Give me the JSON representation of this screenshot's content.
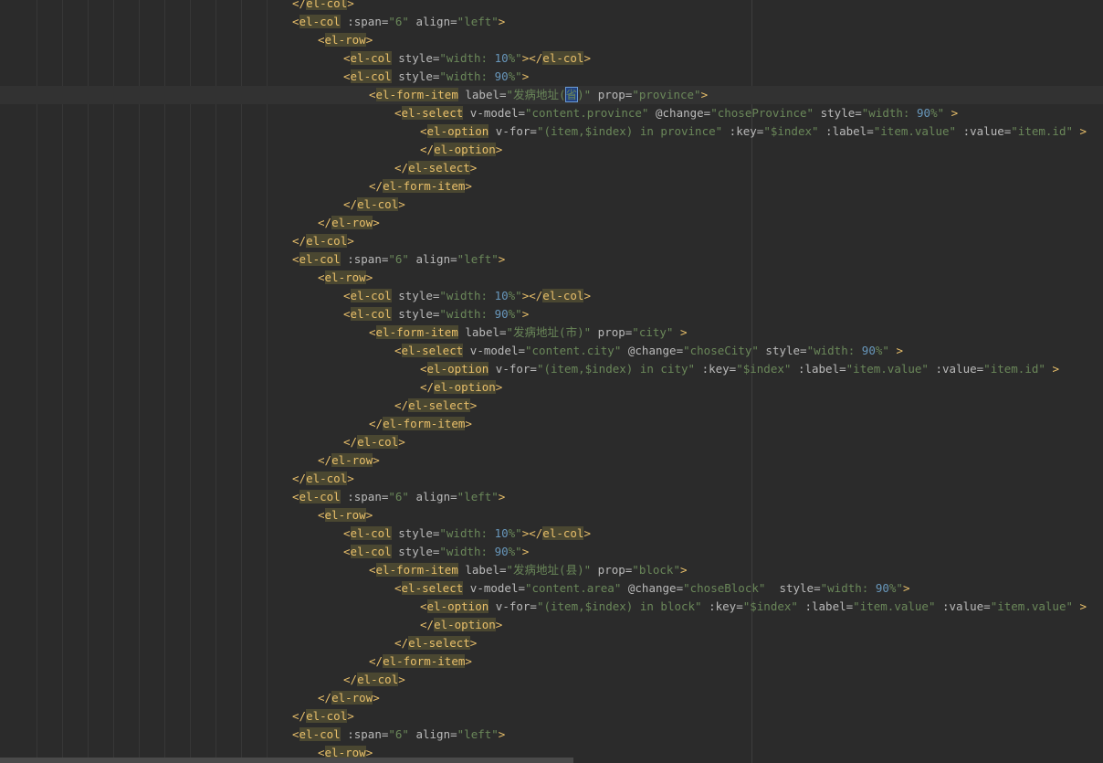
{
  "editor": {
    "lines": [
      [
        [
          "p",
          "</"
        ],
        [
          "t",
          "el-col"
        ],
        [
          "p",
          ">"
        ]
      ],
      [
        [
          "p",
          "<"
        ],
        [
          "t",
          "el-col"
        ],
        [
          "a",
          " :span="
        ],
        [
          "s",
          "\"6\""
        ],
        [
          "a",
          " align="
        ],
        [
          "s",
          "\"left\""
        ],
        [
          "p",
          ">"
        ]
      ],
      [
        [
          "p",
          "<"
        ],
        [
          "t",
          "el-row"
        ],
        [
          "p",
          ">"
        ]
      ],
      [
        [
          "p",
          "<"
        ],
        [
          "t",
          "el-col"
        ],
        [
          "a",
          " style="
        ],
        [
          "s",
          "\"width: "
        ],
        [
          "n",
          "10"
        ],
        [
          "s",
          "%\""
        ],
        [
          "p",
          "></"
        ],
        [
          "t",
          "el-col"
        ],
        [
          "p",
          ">"
        ]
      ],
      [
        [
          "p",
          "<"
        ],
        [
          "t",
          "el-col"
        ],
        [
          "a",
          " style="
        ],
        [
          "s",
          "\"width: "
        ],
        [
          "n",
          "90"
        ],
        [
          "s",
          "%\""
        ],
        [
          "p",
          ">"
        ]
      ],
      [
        [
          "p",
          "<"
        ],
        [
          "t",
          "el-form-item"
        ],
        [
          "a",
          " label="
        ],
        [
          "s",
          "\"发病地址("
        ],
        [
          "c",
          "省"
        ],
        [
          "s",
          ")\""
        ],
        [
          "a",
          " prop="
        ],
        [
          "s",
          "\"province\""
        ],
        [
          "p",
          ">"
        ]
      ],
      [
        [
          "p",
          "<"
        ],
        [
          "t",
          "el-select"
        ],
        [
          "a",
          " v-model="
        ],
        [
          "s",
          "\"content.province\""
        ],
        [
          "a",
          " @change="
        ],
        [
          "s",
          "\"choseProvince\""
        ],
        [
          "a",
          " style="
        ],
        [
          "s",
          "\"width: "
        ],
        [
          "n",
          "90"
        ],
        [
          "s",
          "%\""
        ],
        [
          "a",
          " "
        ],
        [
          "p",
          ">"
        ]
      ],
      [
        [
          "p",
          "<"
        ],
        [
          "t",
          "el-option"
        ],
        [
          "a",
          " v-for="
        ],
        [
          "s",
          "\"(item,$index) in province\""
        ],
        [
          "a",
          " :key="
        ],
        [
          "s",
          "\"$index\""
        ],
        [
          "a",
          " :label="
        ],
        [
          "s",
          "\"item.value\""
        ],
        [
          "a",
          " :value="
        ],
        [
          "s",
          "\"item.id\""
        ],
        [
          "a",
          " "
        ],
        [
          "p",
          ">"
        ]
      ],
      [
        [
          "p",
          "</"
        ],
        [
          "t",
          "el-option"
        ],
        [
          "p",
          ">"
        ]
      ],
      [
        [
          "p",
          "</"
        ],
        [
          "t",
          "el-select"
        ],
        [
          "p",
          ">"
        ]
      ],
      [
        [
          "p",
          "</"
        ],
        [
          "t",
          "el-form-item"
        ],
        [
          "p",
          ">"
        ]
      ],
      [
        [
          "p",
          "</"
        ],
        [
          "t",
          "el-col"
        ],
        [
          "p",
          ">"
        ]
      ],
      [
        [
          "p",
          "</"
        ],
        [
          "t",
          "el-row"
        ],
        [
          "p",
          ">"
        ]
      ],
      [
        [
          "p",
          "</"
        ],
        [
          "t",
          "el-col"
        ],
        [
          "p",
          ">"
        ]
      ],
      [
        [
          "p",
          "<"
        ],
        [
          "t",
          "el-col"
        ],
        [
          "a",
          " :span="
        ],
        [
          "s",
          "\"6\""
        ],
        [
          "a",
          " align="
        ],
        [
          "s",
          "\"left\""
        ],
        [
          "p",
          ">"
        ]
      ],
      [
        [
          "p",
          "<"
        ],
        [
          "t",
          "el-row"
        ],
        [
          "p",
          ">"
        ]
      ],
      [
        [
          "p",
          "<"
        ],
        [
          "t",
          "el-col"
        ],
        [
          "a",
          " style="
        ],
        [
          "s",
          "\"width: "
        ],
        [
          "n",
          "10"
        ],
        [
          "s",
          "%\""
        ],
        [
          "p",
          "></"
        ],
        [
          "t",
          "el-col"
        ],
        [
          "p",
          ">"
        ]
      ],
      [
        [
          "p",
          "<"
        ],
        [
          "t",
          "el-col"
        ],
        [
          "a",
          " style="
        ],
        [
          "s",
          "\"width: "
        ],
        [
          "n",
          "90"
        ],
        [
          "s",
          "%\""
        ],
        [
          "p",
          ">"
        ]
      ],
      [
        [
          "p",
          "<"
        ],
        [
          "t",
          "el-form-item"
        ],
        [
          "a",
          " label="
        ],
        [
          "s",
          "\"发病地址(市)\""
        ],
        [
          "a",
          " prop="
        ],
        [
          "s",
          "\"city\""
        ],
        [
          "a",
          " "
        ],
        [
          "p",
          ">"
        ]
      ],
      [
        [
          "p",
          "<"
        ],
        [
          "t",
          "el-select"
        ],
        [
          "a",
          " v-model="
        ],
        [
          "s",
          "\"content.city\""
        ],
        [
          "a",
          " @change="
        ],
        [
          "s",
          "\"choseCity\""
        ],
        [
          "a",
          " style="
        ],
        [
          "s",
          "\"width: "
        ],
        [
          "n",
          "90"
        ],
        [
          "s",
          "%\""
        ],
        [
          "a",
          " "
        ],
        [
          "p",
          ">"
        ]
      ],
      [
        [
          "p",
          "<"
        ],
        [
          "t",
          "el-option"
        ],
        [
          "a",
          " v-for="
        ],
        [
          "s",
          "\"(item,$index) in city\""
        ],
        [
          "a",
          " :key="
        ],
        [
          "s",
          "\"$index\""
        ],
        [
          "a",
          " :label="
        ],
        [
          "s",
          "\"item.value\""
        ],
        [
          "a",
          " :value="
        ],
        [
          "s",
          "\"item.id\""
        ],
        [
          "a",
          " "
        ],
        [
          "p",
          ">"
        ]
      ],
      [
        [
          "p",
          "</"
        ],
        [
          "t",
          "el-option"
        ],
        [
          "p",
          ">"
        ]
      ],
      [
        [
          "p",
          "</"
        ],
        [
          "t",
          "el-select"
        ],
        [
          "p",
          ">"
        ]
      ],
      [
        [
          "p",
          "</"
        ],
        [
          "t",
          "el-form-item"
        ],
        [
          "p",
          ">"
        ]
      ],
      [
        [
          "p",
          "</"
        ],
        [
          "t",
          "el-col"
        ],
        [
          "p",
          ">"
        ]
      ],
      [
        [
          "p",
          "</"
        ],
        [
          "t",
          "el-row"
        ],
        [
          "p",
          ">"
        ]
      ],
      [
        [
          "p",
          "</"
        ],
        [
          "t",
          "el-col"
        ],
        [
          "p",
          ">"
        ]
      ],
      [
        [
          "p",
          "<"
        ],
        [
          "t",
          "el-col"
        ],
        [
          "a",
          " :span="
        ],
        [
          "s",
          "\"6\""
        ],
        [
          "a",
          " align="
        ],
        [
          "s",
          "\"left\""
        ],
        [
          "p",
          ">"
        ]
      ],
      [
        [
          "p",
          "<"
        ],
        [
          "t",
          "el-row"
        ],
        [
          "p",
          ">"
        ]
      ],
      [
        [
          "p",
          "<"
        ],
        [
          "t",
          "el-col"
        ],
        [
          "a",
          " style="
        ],
        [
          "s",
          "\"width: "
        ],
        [
          "n",
          "10"
        ],
        [
          "s",
          "%\""
        ],
        [
          "p",
          "></"
        ],
        [
          "t",
          "el-col"
        ],
        [
          "p",
          ">"
        ]
      ],
      [
        [
          "p",
          "<"
        ],
        [
          "t",
          "el-col"
        ],
        [
          "a",
          " style="
        ],
        [
          "s",
          "\"width: "
        ],
        [
          "n",
          "90"
        ],
        [
          "s",
          "%\""
        ],
        [
          "p",
          ">"
        ]
      ],
      [
        [
          "p",
          "<"
        ],
        [
          "t",
          "el-form-item"
        ],
        [
          "a",
          " label="
        ],
        [
          "s",
          "\"发病地址(县)\""
        ],
        [
          "a",
          " prop="
        ],
        [
          "s",
          "\"block\""
        ],
        [
          "p",
          ">"
        ]
      ],
      [
        [
          "p",
          "<"
        ],
        [
          "t",
          "el-select"
        ],
        [
          "a",
          " v-model="
        ],
        [
          "s",
          "\"content.area\""
        ],
        [
          "a",
          " @change="
        ],
        [
          "s",
          "\"choseBlock\""
        ],
        [
          "a",
          "  style="
        ],
        [
          "s",
          "\"width: "
        ],
        [
          "n",
          "90"
        ],
        [
          "s",
          "%\""
        ],
        [
          "p",
          ">"
        ]
      ],
      [
        [
          "p",
          "<"
        ],
        [
          "t",
          "el-option"
        ],
        [
          "a",
          " v-for="
        ],
        [
          "s",
          "\"(item,$index) in block\""
        ],
        [
          "a",
          " :key="
        ],
        [
          "s",
          "\"$index\""
        ],
        [
          "a",
          " :label="
        ],
        [
          "s",
          "\"item.value\""
        ],
        [
          "a",
          " :value="
        ],
        [
          "s",
          "\"item.value\""
        ],
        [
          "a",
          " "
        ],
        [
          "p",
          ">"
        ]
      ],
      [
        [
          "p",
          "</"
        ],
        [
          "t",
          "el-option"
        ],
        [
          "p",
          ">"
        ]
      ],
      [
        [
          "p",
          "</"
        ],
        [
          "t",
          "el-select"
        ],
        [
          "p",
          ">"
        ]
      ],
      [
        [
          "p",
          "</"
        ],
        [
          "t",
          "el-form-item"
        ],
        [
          "p",
          ">"
        ]
      ],
      [
        [
          "p",
          "</"
        ],
        [
          "t",
          "el-col"
        ],
        [
          "p",
          ">"
        ]
      ],
      [
        [
          "p",
          "</"
        ],
        [
          "t",
          "el-row"
        ],
        [
          "p",
          ">"
        ]
      ],
      [
        [
          "p",
          "</"
        ],
        [
          "t",
          "el-col"
        ],
        [
          "p",
          ">"
        ]
      ],
      [
        [
          "p",
          "<"
        ],
        [
          "t",
          "el-col"
        ],
        [
          "a",
          " :span="
        ],
        [
          "s",
          "\"6\""
        ],
        [
          "a",
          " align="
        ],
        [
          "s",
          "\"left\""
        ],
        [
          "p",
          ">"
        ]
      ],
      [
        [
          "p",
          "<"
        ],
        [
          "t",
          "el-row"
        ],
        [
          "p",
          ">"
        ]
      ]
    ]
  }
}
